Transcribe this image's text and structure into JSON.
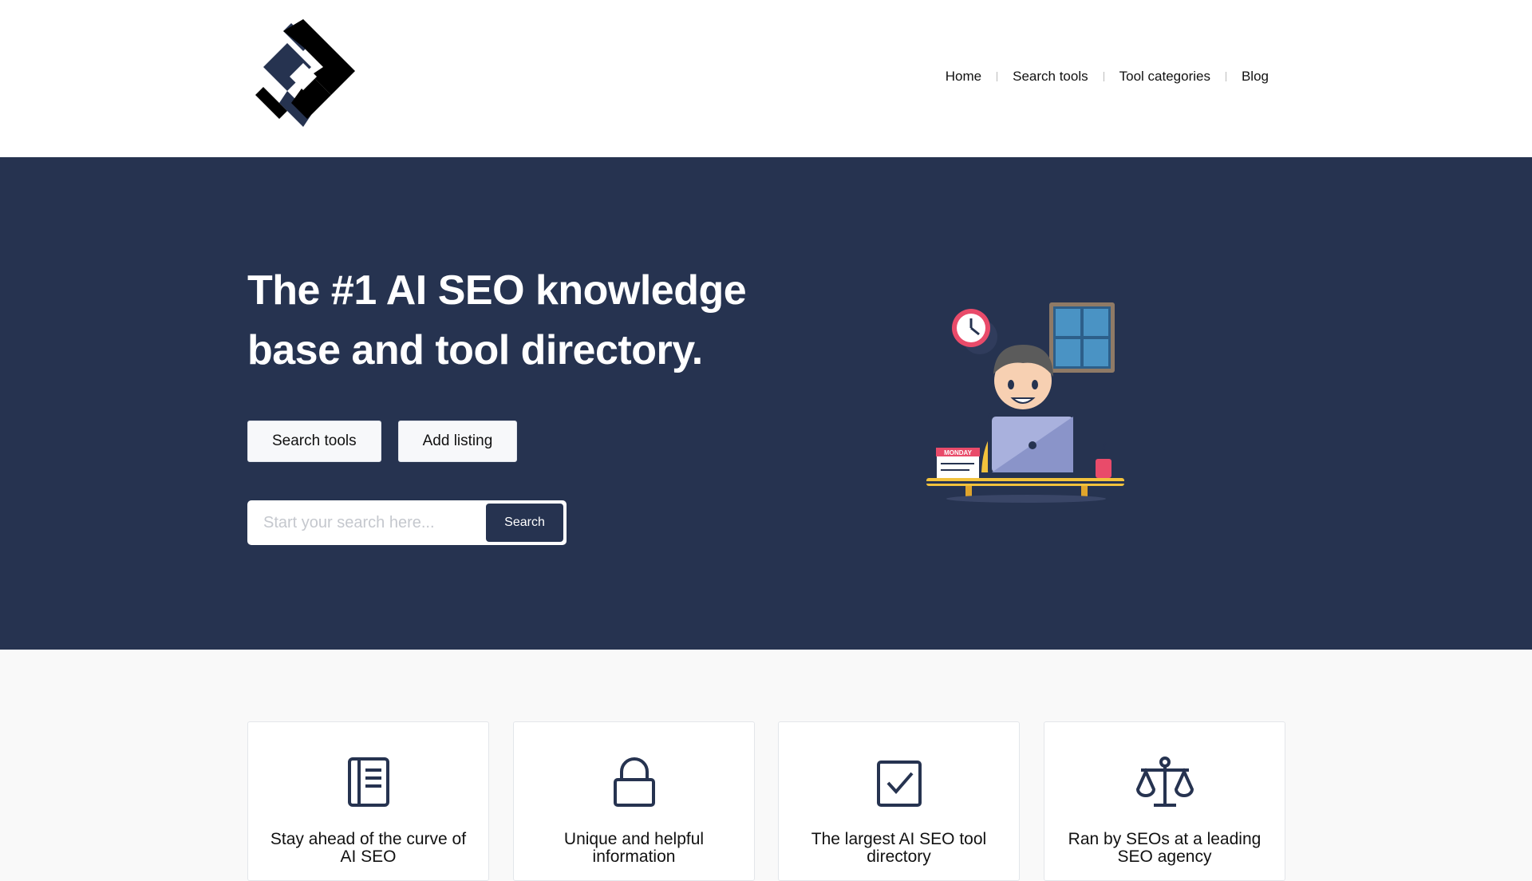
{
  "nav": {
    "items": [
      "Home",
      "Search tools",
      "Tool categories",
      "Blog"
    ]
  },
  "hero": {
    "headline": "The #1 AI SEO knowledge base and tool directory.",
    "buttons": {
      "search_tools": "Search tools",
      "add_listing": "Add listing"
    },
    "search": {
      "placeholder": "Start your search here...",
      "value": "",
      "button": "Search"
    },
    "illustration": {
      "calendar_label": "MONDAY"
    }
  },
  "features": [
    {
      "icon": "book-icon",
      "title": "Stay ahead of the curve of AI SEO"
    },
    {
      "icon": "lock-icon",
      "title": "Unique and helpful information"
    },
    {
      "icon": "checkbox-icon",
      "title": "The largest AI SEO tool directory"
    },
    {
      "icon": "scales-icon",
      "title": "Ran by SEOs at a leading SEO agency"
    }
  ],
  "colors": {
    "navy": "#263350",
    "white": "#ffffff",
    "page_bg": "#f9f9f9"
  }
}
